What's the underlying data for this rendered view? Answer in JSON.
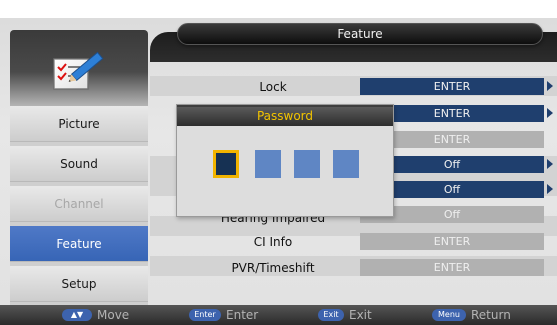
{
  "header": {
    "title": "Feature"
  },
  "sidebar": {
    "items": [
      {
        "label": "Picture",
        "state": "normal"
      },
      {
        "label": "Sound",
        "state": "normal"
      },
      {
        "label": "Channel",
        "state": "disabled"
      },
      {
        "label": "Feature",
        "state": "active"
      },
      {
        "label": "Setup",
        "state": "normal"
      }
    ]
  },
  "rows": [
    {
      "label": "Lock",
      "value": "ENTER",
      "style": "dark",
      "arrow": true
    },
    {
      "label": "",
      "value": "ENTER",
      "style": "dark",
      "arrow": true
    },
    {
      "label": "",
      "value": "ENTER",
      "style": "gray",
      "arrow": false
    },
    {
      "label": "",
      "value": "Off",
      "style": "dark",
      "arrow": true
    },
    {
      "label": "",
      "value": "Off",
      "style": "dark",
      "arrow": true
    },
    {
      "label": "Hearing Impaired",
      "value": "Off",
      "style": "gray",
      "arrow": false
    },
    {
      "label": "CI Info",
      "value": "ENTER",
      "style": "gray",
      "arrow": false
    },
    {
      "label": "PVR/Timeshift",
      "value": "ENTER",
      "style": "gray",
      "arrow": false
    }
  ],
  "dialog": {
    "title": "Password",
    "digits_entered": 0,
    "digits_total": 4
  },
  "help_bar": {
    "items": [
      {
        "key": "▲▼",
        "label": "Move"
      },
      {
        "key": "Enter",
        "label": "Enter"
      },
      {
        "key": "Exit",
        "label": "Exit"
      },
      {
        "key": "Menu",
        "label": "Return"
      }
    ]
  },
  "colors": {
    "accent_blue": "#3765b6",
    "value_dark": "#1f3f6e",
    "value_gray": "#b1b1b1",
    "pin_box": "#5f86c4",
    "pin_focus_border": "#f2b400",
    "dialog_title_text": "#f3c400"
  },
  "icons": {
    "menu_icon": "checklist-pencil-icon"
  }
}
